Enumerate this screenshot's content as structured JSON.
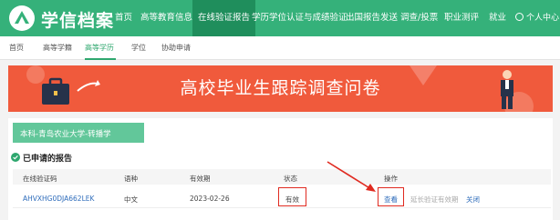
{
  "brand": {
    "name": "学信档案"
  },
  "nav": {
    "items": [
      "首页",
      "高等教育信息",
      "在线验证报告",
      "学历学位认证与成绩验证",
      "出国报告发送",
      "调查/投票",
      "职业测评",
      "就业"
    ],
    "active_index": 2,
    "user": "个人中心"
  },
  "subnav": {
    "items": [
      "首页",
      "高等学籍",
      "高等学历",
      "学位",
      "协助申请"
    ],
    "active_index": 2
  },
  "banner": {
    "title": "高校毕业生跟踪调查问卷"
  },
  "tag": {
    "text": "本科-青岛农业大学-转播学"
  },
  "section": {
    "title": "已申请的报告"
  },
  "table": {
    "headers": [
      "在线验证码",
      "语种",
      "有效期",
      "状态",
      "操作"
    ],
    "rows": [
      {
        "code": "AHVXHG0DJA662LEK",
        "language": "中文",
        "expiry": "2023-02-26",
        "status": "有效",
        "actions": [
          "查看",
          "延长验证有效期",
          "关闭"
        ]
      }
    ]
  },
  "colors": {
    "primary": "#35b17a",
    "nav_active": "#1f8e5c",
    "banner": "#f05a3c",
    "link": "#2f6dbb",
    "highlight": "#e02a20"
  },
  "icons": [
    "logo-icon",
    "user-icon",
    "briefcase-icon",
    "arrow-icon",
    "check-circle-icon",
    "annotation-arrow-icon",
    "businessman-icon"
  ]
}
